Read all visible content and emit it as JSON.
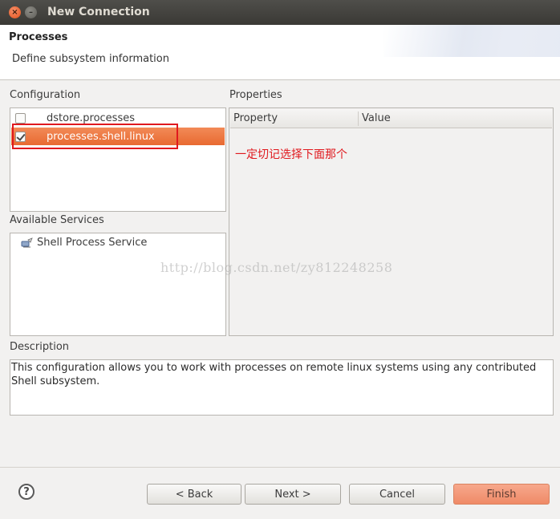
{
  "window": {
    "title": "New Connection"
  },
  "banner": {
    "title": "Processes",
    "description": "Define subsystem information"
  },
  "configuration": {
    "label": "Configuration",
    "items": [
      {
        "label": "dstore.processes",
        "checked": false,
        "selected": false
      },
      {
        "label": "processes.shell.linux",
        "checked": true,
        "selected": true
      }
    ]
  },
  "properties": {
    "label": "Properties",
    "columns": [
      "Property",
      "Value"
    ]
  },
  "annotation": "一定切记选择下面那个",
  "services": {
    "label": "Available Services",
    "items": [
      {
        "label": "Shell Process Service",
        "icon": "service-icon"
      }
    ]
  },
  "watermark": "http://blog.csdn.net/zy812248258",
  "description": {
    "label": "Description",
    "text": "This configuration allows you to work with processes on remote linux systems using any contributed Shell subsystem."
  },
  "buttons": {
    "help": "?",
    "back": "< Back",
    "next": "Next >",
    "cancel": "Cancel",
    "finish": "Finish"
  },
  "colors": {
    "selection": "#e86a31",
    "annotation": "#e0191e",
    "finish": "#ef8a67",
    "titlebar": "#3c3b37"
  }
}
